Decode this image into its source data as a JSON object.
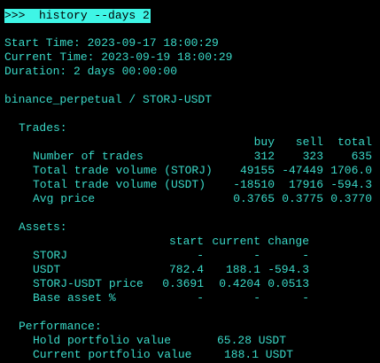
{
  "prompt_line": ">>>  history --days 2",
  "times": {
    "start": "Start Time: 2023-09-17 18:00:29",
    "current": "Current Time: 2023-09-19 18:00:29",
    "duration": "Duration: 2 days 00:00:00"
  },
  "market": "binance_perpetual / STORJ-USDT",
  "trades": {
    "heading": "Trades:",
    "columns": [
      "buy",
      "sell",
      "total"
    ],
    "rows": [
      {
        "label": "Number of trades",
        "values": [
          "312",
          "323",
          "635"
        ]
      },
      {
        "label": "Total trade volume (STORJ)",
        "values": [
          "49155",
          "-47449",
          "1706.0"
        ]
      },
      {
        "label": "Total trade volume (USDT)",
        "values": [
          "-18510",
          "17916",
          "-594.3"
        ]
      },
      {
        "label": "Avg price",
        "values": [
          "0.3765",
          "0.3775",
          "0.3770"
        ]
      }
    ]
  },
  "assets": {
    "heading": "Assets:",
    "columns": [
      "start",
      "current",
      "change"
    ],
    "rows": [
      {
        "label": "STORJ",
        "values": [
          "-",
          "-",
          "-"
        ]
      },
      {
        "label": "USDT",
        "values": [
          "782.4",
          "188.1",
          "-594.3"
        ]
      },
      {
        "label": "STORJ-USDT price",
        "values": [
          "0.3691",
          "0.4204",
          "0.0513"
        ]
      },
      {
        "label": "Base asset %",
        "values": [
          "-",
          "-",
          "-"
        ]
      }
    ]
  },
  "performance": {
    "heading": "Performance:",
    "rows": [
      {
        "label": "Hold portfolio value",
        "value": "65.28 USDT"
      },
      {
        "label": "Current portfolio value",
        "value": "188.1 USDT"
      }
    ]
  },
  "colors": {
    "background": "#000000",
    "text": "#3ad9c8",
    "prompt_highlight": "#3ff5e6"
  }
}
